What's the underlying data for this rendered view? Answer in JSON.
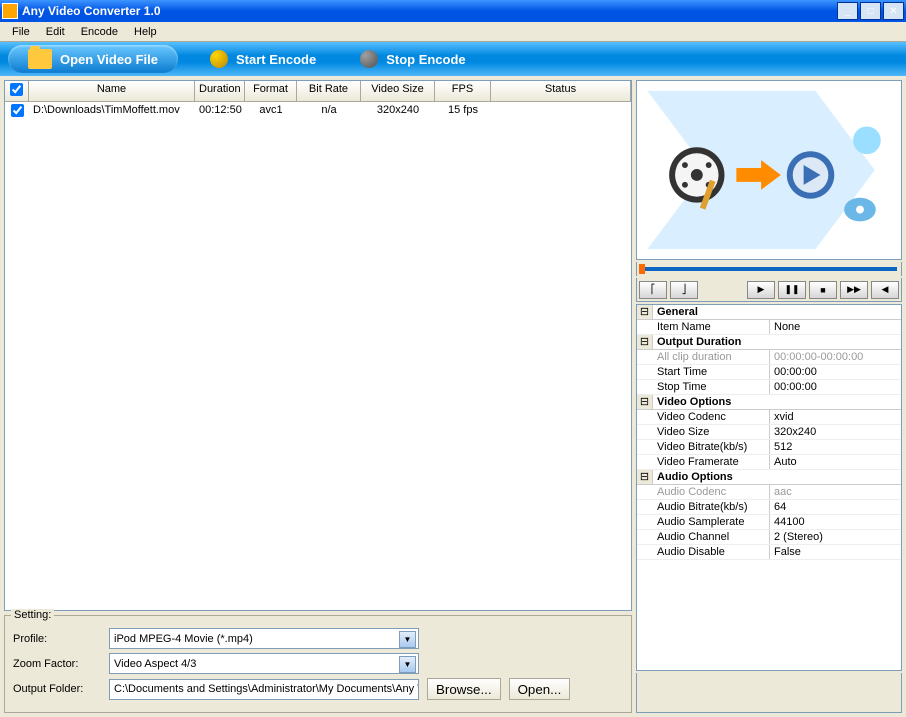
{
  "titlebar": {
    "title": "Any Video Converter 1.0"
  },
  "menu": {
    "file": "File",
    "edit": "Edit",
    "encode": "Encode",
    "help": "Help"
  },
  "toolbar": {
    "open": "Open Video File",
    "start": "Start  Encode",
    "stop": "Stop  Encode"
  },
  "grid": {
    "headers": {
      "name": "Name",
      "duration": "Duration",
      "format": "Format",
      "bitrate": "Bit Rate",
      "videosize": "Video Size",
      "fps": "FPS",
      "status": "Status"
    },
    "rows": [
      {
        "checked": true,
        "name": "D:\\Downloads\\TimMoffett.mov",
        "duration": "00:12:50",
        "format": "avc1",
        "bitrate": "n/a",
        "videosize": "320x240",
        "fps": "15 fps",
        "status": ""
      }
    ]
  },
  "setting": {
    "legend": "Setting:",
    "profile_label": "Profile:",
    "profile_value": "iPod MPEG-4 Movie (*.mp4)",
    "zoom_label": "Zoom Factor:",
    "zoom_value": "Video Aspect 4/3",
    "output_label": "Output Folder:",
    "output_value": "C:\\Documents and Settings\\Administrator\\My Documents\\Any Video C",
    "browse": "Browse...",
    "open": "Open..."
  },
  "props": {
    "sections": [
      {
        "title": "General",
        "rows": [
          {
            "key": "Item Name",
            "val": "None",
            "disabled": false
          }
        ]
      },
      {
        "title": "Output Duration",
        "rows": [
          {
            "key": "All clip duration",
            "val": "00:00:00-00:00:00",
            "disabled": true
          },
          {
            "key": "Start Time",
            "val": "00:00:00",
            "disabled": false
          },
          {
            "key": "Stop Time",
            "val": "00:00:00",
            "disabled": false
          }
        ]
      },
      {
        "title": "Video Options",
        "rows": [
          {
            "key": "Video Codenc",
            "val": "xvid",
            "disabled": false
          },
          {
            "key": "Video Size",
            "val": "320x240",
            "disabled": false
          },
          {
            "key": "Video Bitrate(kb/s)",
            "val": "512",
            "disabled": false
          },
          {
            "key": "Video Framerate",
            "val": "Auto",
            "disabled": false
          }
        ]
      },
      {
        "title": "Audio Options",
        "rows": [
          {
            "key": "Audio Codenc",
            "val": "aac",
            "disabled": true
          },
          {
            "key": "Audio Bitrate(kb/s)",
            "val": "64",
            "disabled": false
          },
          {
            "key": "Audio Samplerate",
            "val": "44100",
            "disabled": false
          },
          {
            "key": "Audio Channel",
            "val": "2 (Stereo)",
            "disabled": false
          },
          {
            "key": "Audio Disable",
            "val": "False",
            "disabled": false
          }
        ]
      }
    ]
  }
}
